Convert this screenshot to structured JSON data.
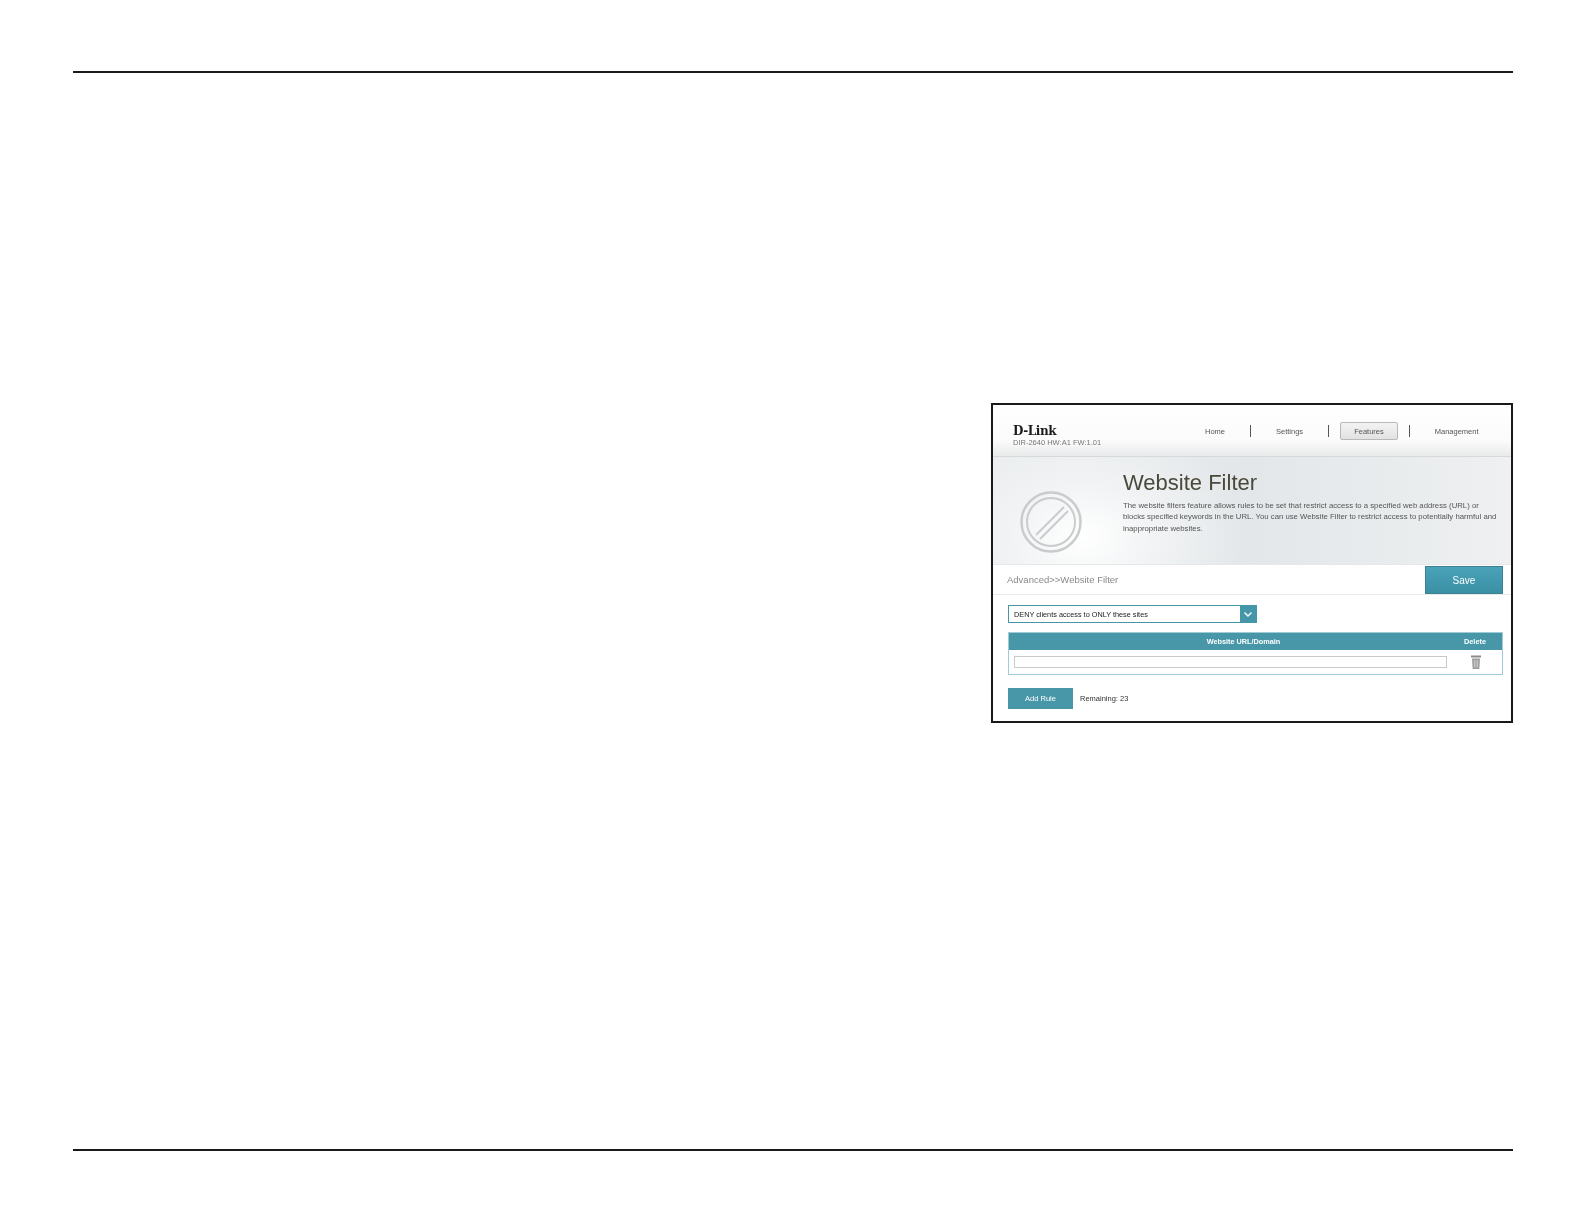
{
  "screenshot": {
    "header": {
      "logo": "D-Link",
      "model": "DIR-2640 HW:A1 FW:1.01",
      "nav": [
        {
          "label": "Home",
          "selected": false
        },
        {
          "label": "Settings",
          "selected": false
        },
        {
          "label": "Features",
          "selected": true
        },
        {
          "label": "Management",
          "selected": false
        }
      ]
    },
    "banner": {
      "title": "Website Filter",
      "description": "The website filters feature allows rules to be set that restrict access to a specified web address (URL) or blocks specified keywords in the URL. You can use Website Filter to restrict access to potentially harmful and inappropriate websites."
    },
    "toolbar": {
      "breadcrumb": "Advanced>>Website Filter",
      "save_button": "Save"
    },
    "filter_mode": {
      "value": "DENY clients access to ONLY these sites"
    },
    "table": {
      "columns": [
        "Website URL/Domain",
        "Delete"
      ]
    },
    "footer": {
      "add_rule_button": "Add Rule",
      "remaining": "Remaining: 23"
    }
  }
}
